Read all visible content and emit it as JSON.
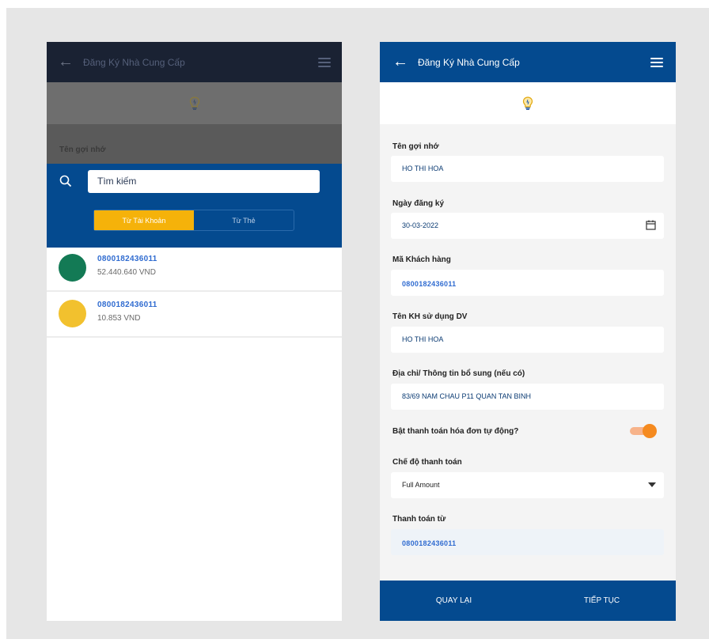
{
  "colors": {
    "primary_blue": "#044a8f",
    "accent_yellow": "#f5b20a",
    "toggle_orange": "#f58a1f",
    "account_green": "#137a55",
    "account_yellow": "#f2c12e"
  },
  "left_screen": {
    "header": {
      "title": "Đăng Ký Nhà Cung Cấp",
      "back_icon": "arrow-left-icon",
      "menu_icon": "hamburger-menu-icon"
    },
    "logo_icon": "lightbulb-icon",
    "nickname_label": "Tên gợi nhớ",
    "search": {
      "icon": "search-icon",
      "value": "Tìm kiếm"
    },
    "tabs": {
      "active": "Từ Tài Khoản",
      "inactive": "Từ Thẻ"
    },
    "accounts": [
      {
        "number": "0800182436011",
        "balance": "52.440.640 VND",
        "color": "#137a55"
      },
      {
        "number": "0800182436011",
        "balance": "10.853 VND",
        "color": "#f2c12e"
      }
    ]
  },
  "right_screen": {
    "header": {
      "title": "Đăng Ký Nhà Cung Cấp",
      "back_icon": "arrow-left-icon",
      "menu_icon": "hamburger-menu-icon"
    },
    "logo_icon": "lightbulb-icon",
    "fields": {
      "nickname": {
        "label": "Tên gợi nhớ",
        "value": "HO THI HOA"
      },
      "register_date": {
        "label": "Ngày đăng ký",
        "value": "30-03-2022",
        "icon": "calendar-icon"
      },
      "customer_code": {
        "label": "Mã Khách hàng",
        "value": "0800182436011"
      },
      "service_user": {
        "label": "Tên KH sử dụng DV",
        "value": "HO THI HOA"
      },
      "address": {
        "label": "Địa chỉ/ Thông tin bổ sung (nếu có)",
        "value": "83/69 NAM CHAU P11 QUAN TAN BINH"
      },
      "auto_pay": {
        "label": "Bật thanh toán hóa đơn tự động?",
        "enabled": true
      },
      "payment_mode": {
        "label": "Chế độ thanh toán",
        "value": "Full Amount",
        "icon": "caret-down-icon"
      },
      "pay_from": {
        "label": "Thanh toán từ",
        "value": "0800182436011"
      }
    },
    "buttons": {
      "back": "QUAY LẠI",
      "next": "TIẾP TỤC"
    }
  }
}
